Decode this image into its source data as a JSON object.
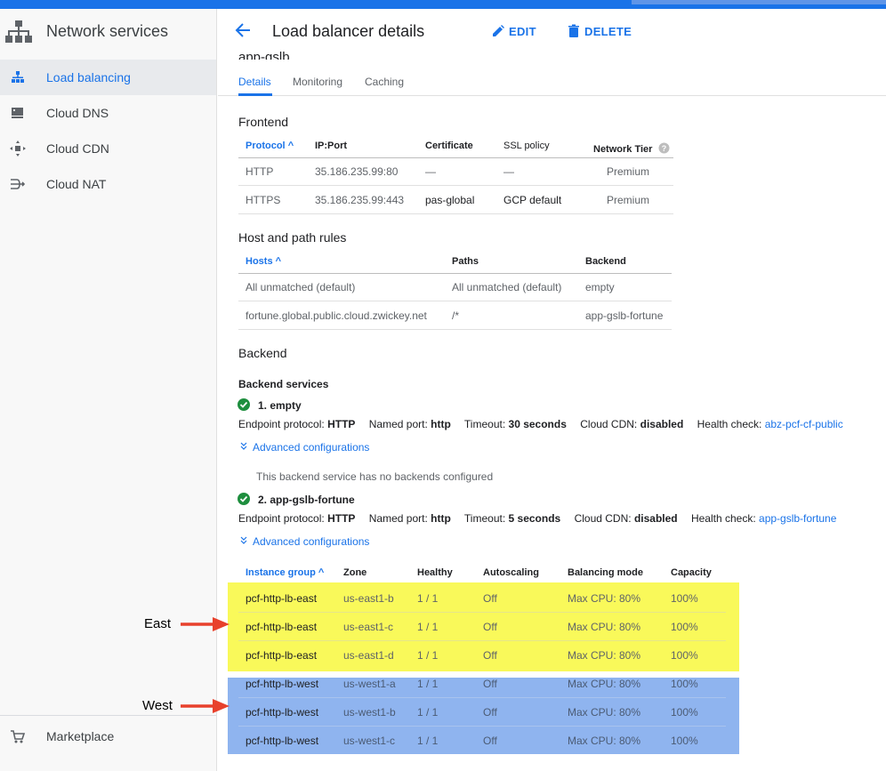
{
  "sidebar": {
    "title": "Network services",
    "items": [
      {
        "label": "Load balancing",
        "icon": "load-balancing-icon",
        "active": true
      },
      {
        "label": "Cloud DNS",
        "icon": "cloud-dns-icon",
        "active": false
      },
      {
        "label": "Cloud CDN",
        "icon": "cloud-cdn-icon",
        "active": false
      },
      {
        "label": "Cloud NAT",
        "icon": "cloud-nat-icon",
        "active": false
      }
    ],
    "marketplace": "Marketplace"
  },
  "header": {
    "title": "Load balancer details",
    "edit": "EDIT",
    "delete": "DELETE"
  },
  "lb_name": "app-gslb",
  "tabs": [
    "Details",
    "Monitoring",
    "Caching"
  ],
  "frontend": {
    "title": "Frontend",
    "headers": [
      "Protocol",
      "IP:Port",
      "Certificate",
      "SSL policy",
      "Network Tier"
    ],
    "rows": [
      [
        "HTTP",
        "35.186.235.99:80",
        "—",
        "—",
        "Premium"
      ],
      [
        "HTTPS",
        "35.186.235.99:443",
        "pas-global",
        "GCP default",
        "Premium"
      ]
    ]
  },
  "host_rules": {
    "title": "Host and path rules",
    "headers": [
      "Hosts",
      "Paths",
      "Backend"
    ],
    "rows": [
      [
        "All unmatched (default)",
        "All unmatched (default)",
        "empty"
      ],
      [
        "fortune.global.public.cloud.zwickey.net",
        "/*",
        "app-gslb-fortune"
      ]
    ]
  },
  "backend": {
    "title": "Backend",
    "services_title": "Backend services",
    "labels": {
      "endpoint": "Endpoint protocol:",
      "port": "Named port:",
      "timeout": "Timeout:",
      "cdn": "Cloud CDN:",
      "health": "Health check:"
    },
    "services": [
      {
        "name": "1. empty",
        "protocol": "HTTP",
        "port": "http",
        "timeout": "30 seconds",
        "cdn": "disabled",
        "health": "abz-pcf-cf-public",
        "advanced": "Advanced configurations",
        "note": "This backend service has no backends configured"
      },
      {
        "name": "2. app-gslb-fortune",
        "protocol": "HTTP",
        "port": "http",
        "timeout": "5 seconds",
        "cdn": "disabled",
        "health": "app-gslb-fortune",
        "advanced": "Advanced configurations"
      }
    ],
    "ig_headers": [
      "Instance group",
      "Zone",
      "Healthy",
      "Autoscaling",
      "Balancing mode",
      "Capacity"
    ],
    "ig_rows": [
      [
        "pcf-http-lb-east",
        "us-east1-b",
        "1 / 1",
        "Off",
        "Max CPU: 80%",
        "100%"
      ],
      [
        "pcf-http-lb-east",
        "us-east1-c",
        "1 / 1",
        "Off",
        "Max CPU: 80%",
        "100%"
      ],
      [
        "pcf-http-lb-east",
        "us-east1-d",
        "1 / 1",
        "Off",
        "Max CPU: 80%",
        "100%"
      ],
      [
        "pcf-http-lb-west",
        "us-west1-a",
        "1 / 1",
        "Off",
        "Max CPU: 80%",
        "100%"
      ],
      [
        "pcf-http-lb-west",
        "us-west1-b",
        "1 / 1",
        "Off",
        "Max CPU: 80%",
        "100%"
      ],
      [
        "pcf-http-lb-west",
        "us-west1-c",
        "1 / 1",
        "Off",
        "Max CPU: 80%",
        "100%"
      ]
    ]
  },
  "annotations": {
    "east": "East",
    "west": "West"
  },
  "colors": {
    "accent": "#1a73e8",
    "highlight_east": "#f9f95a",
    "highlight_west": "#8fb4ef",
    "arrow": "#e8412c",
    "check": "#1e8e3e"
  }
}
